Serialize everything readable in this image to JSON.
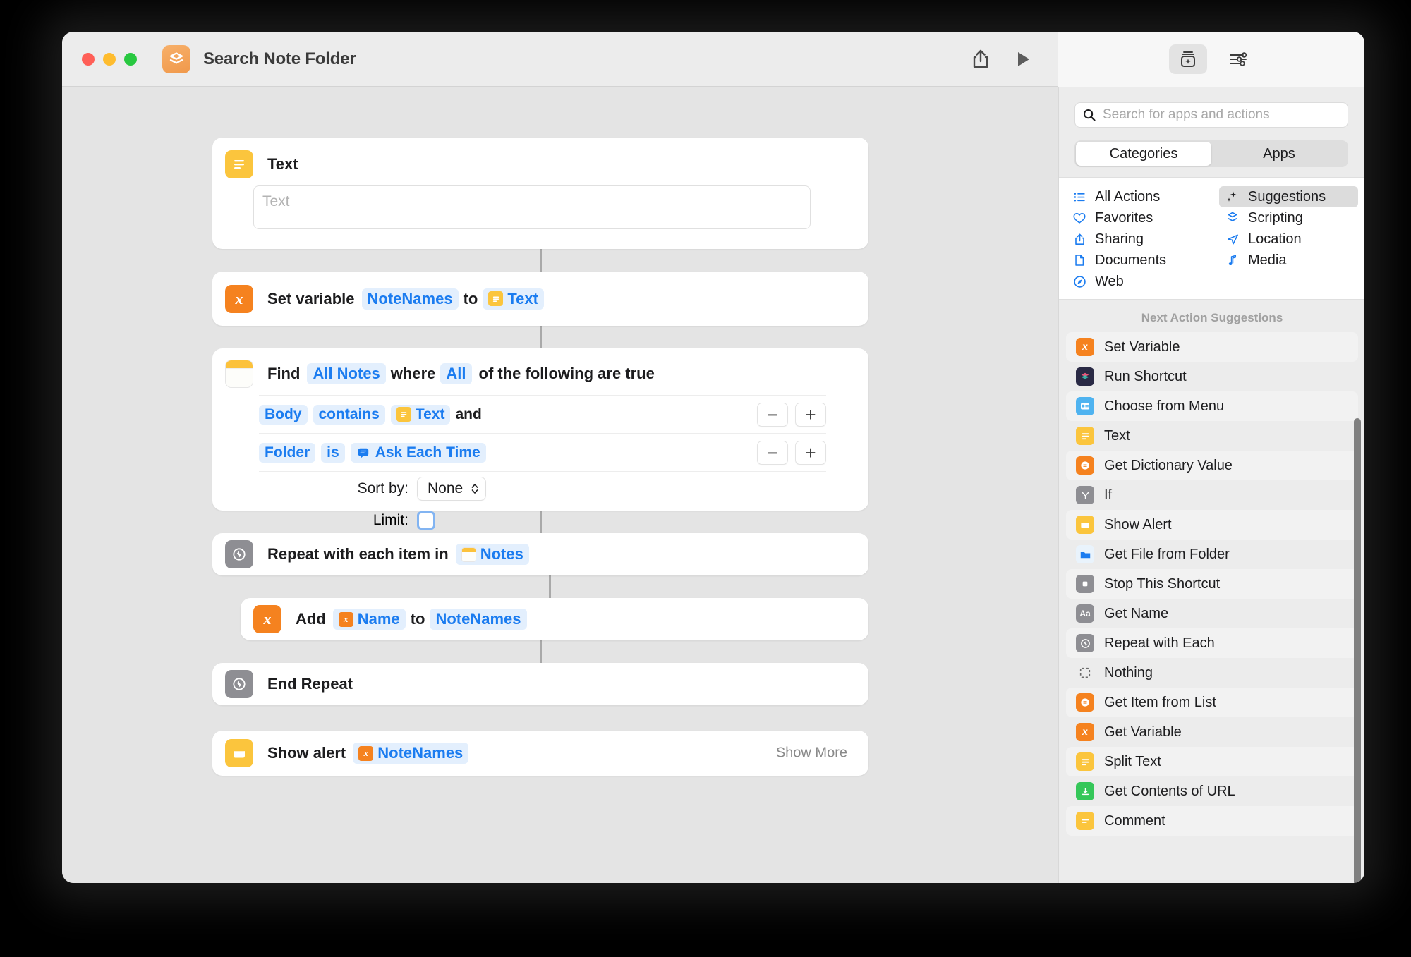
{
  "window": {
    "title": "Search Note Folder",
    "app_icon": "shortcuts-icon",
    "traffic_lights": [
      "close",
      "minimize",
      "zoom"
    ]
  },
  "toolbar": {
    "share_label": "share-icon",
    "run_label": "play-icon",
    "library_toggle_label": "action-library-icon",
    "details_label": "sliders-icon"
  },
  "actions": [
    {
      "id": "text",
      "icon": "text-icon",
      "title": "Text",
      "field_placeholder": "Text"
    },
    {
      "id": "set-variable",
      "icon": "variable-icon",
      "prefix": "Set variable",
      "variable": "NoteNames",
      "joiner": "to",
      "value": "Text",
      "value_icon": "text-icon"
    },
    {
      "id": "find-notes",
      "icon": "notes-icon",
      "prefix": "Find",
      "scope": "All Notes",
      "where": "where",
      "match": "All",
      "suffix": "of the following are true",
      "filters": [
        {
          "field": "Body",
          "operator": "contains",
          "value": "Text",
          "value_icon": "text-icon",
          "conjunction": "and",
          "minus": "−",
          "plus": "+"
        },
        {
          "field": "Folder",
          "operator": "is",
          "value": "Ask Each Time",
          "value_icon": "ask-each-time-icon",
          "conjunction": "",
          "minus": "−",
          "plus": "+"
        }
      ],
      "sort_label": "Sort by:",
      "sort_value": "None",
      "limit_label": "Limit:",
      "limit_checked": false
    },
    {
      "id": "repeat",
      "icon": "repeat-icon",
      "prefix": "Repeat with each item in",
      "value": "Notes",
      "value_icon": "notes-icon"
    },
    {
      "id": "add-to-variable",
      "icon": "variable-icon",
      "prefix": "Add",
      "value": "Name",
      "value_icon": "variable-icon",
      "joiner": "to",
      "variable": "NoteNames"
    },
    {
      "id": "end-repeat",
      "icon": "repeat-icon",
      "title": "End Repeat"
    },
    {
      "id": "show-alert",
      "icon": "show-alert-icon",
      "prefix": "Show alert",
      "value": "NoteNames",
      "value_icon": "variable-icon",
      "show_more": "Show More"
    }
  ],
  "library": {
    "search": {
      "placeholder": "Search for apps and actions",
      "icon": "search-icon",
      "value": ""
    },
    "tabs": [
      {
        "label": "Categories",
        "selected": true
      },
      {
        "label": "Apps",
        "selected": false
      }
    ],
    "categories_left": [
      {
        "label": "All Actions",
        "icon": "list-bullet-icon",
        "selected": false
      },
      {
        "label": "Favorites",
        "icon": "heart-icon",
        "selected": false
      },
      {
        "label": "Sharing",
        "icon": "share-icon",
        "selected": false
      },
      {
        "label": "Documents",
        "icon": "document-icon",
        "selected": false
      },
      {
        "label": "Web",
        "icon": "safari-icon",
        "selected": false
      }
    ],
    "categories_right": [
      {
        "label": "Suggestions",
        "icon": "sparkles-icon",
        "selected": true
      },
      {
        "label": "Scripting",
        "icon": "scripting-icon",
        "selected": false
      },
      {
        "label": "Location",
        "icon": "location-icon",
        "selected": false
      },
      {
        "label": "Media",
        "icon": "music-note-icon",
        "selected": false
      }
    ],
    "suggestions_header": "Next Action Suggestions",
    "suggestions": [
      {
        "label": "Set Variable",
        "icon": "variable-icon"
      },
      {
        "label": "Run Shortcut",
        "icon": "shortcuts-icon"
      },
      {
        "label": "Choose from Menu",
        "icon": "menu-icon"
      },
      {
        "label": "Text",
        "icon": "text-icon"
      },
      {
        "label": "Get Dictionary Value",
        "icon": "dictionary-icon"
      },
      {
        "label": "If",
        "icon": "if-icon"
      },
      {
        "label": "Show Alert",
        "icon": "show-alert-icon"
      },
      {
        "label": "Get File from Folder",
        "icon": "folder-icon"
      },
      {
        "label": "Stop This Shortcut",
        "icon": "stop-icon"
      },
      {
        "label": "Get Name",
        "icon": "get-name-icon"
      },
      {
        "label": "Repeat with Each",
        "icon": "repeat-icon"
      },
      {
        "label": "Nothing",
        "icon": "nothing-icon"
      },
      {
        "label": "Get Item from List",
        "icon": "list-icon"
      },
      {
        "label": "Get Variable",
        "icon": "variable-icon"
      },
      {
        "label": "Split Text",
        "icon": "text-icon"
      },
      {
        "label": "Get Contents of URL",
        "icon": "url-icon"
      },
      {
        "label": "Comment",
        "icon": "comment-icon"
      }
    ]
  },
  "colors": {
    "accent_blue": "#1b7cf0",
    "token_bg": "#e3effd",
    "variable_orange": "#f5821f",
    "text_yellow": "#fbc53d",
    "canvas_bg": "#e4e4e4"
  }
}
